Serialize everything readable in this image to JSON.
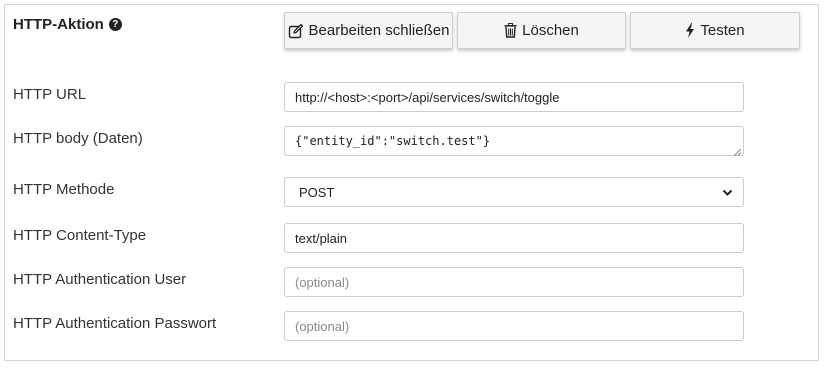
{
  "header": {
    "title": "HTTP-Aktion",
    "help_icon": "question-circle-icon"
  },
  "buttons": {
    "close_edit": {
      "label": "Bearbeiten schließen",
      "icon": "edit-icon"
    },
    "delete": {
      "label": "Löschen",
      "icon": "trash-icon"
    },
    "test": {
      "label": "Testen",
      "icon": "lightning-icon"
    }
  },
  "form": {
    "url": {
      "label": "HTTP URL",
      "value": "http://<host>:<port>/api/services/switch/toggle"
    },
    "body": {
      "label": "HTTP body (Daten)",
      "value": "{\"entity_id\":\"switch.test\"}"
    },
    "method": {
      "label": "HTTP Methode",
      "value": "POST"
    },
    "content_type": {
      "label": "HTTP Content-Type",
      "value": "text/plain"
    },
    "auth_user": {
      "label": "HTTP Authentication User",
      "value": "",
      "placeholder": "(optional)"
    },
    "auth_password": {
      "label": "HTTP Authentication Passwort",
      "value": "",
      "placeholder": "(optional)"
    }
  }
}
